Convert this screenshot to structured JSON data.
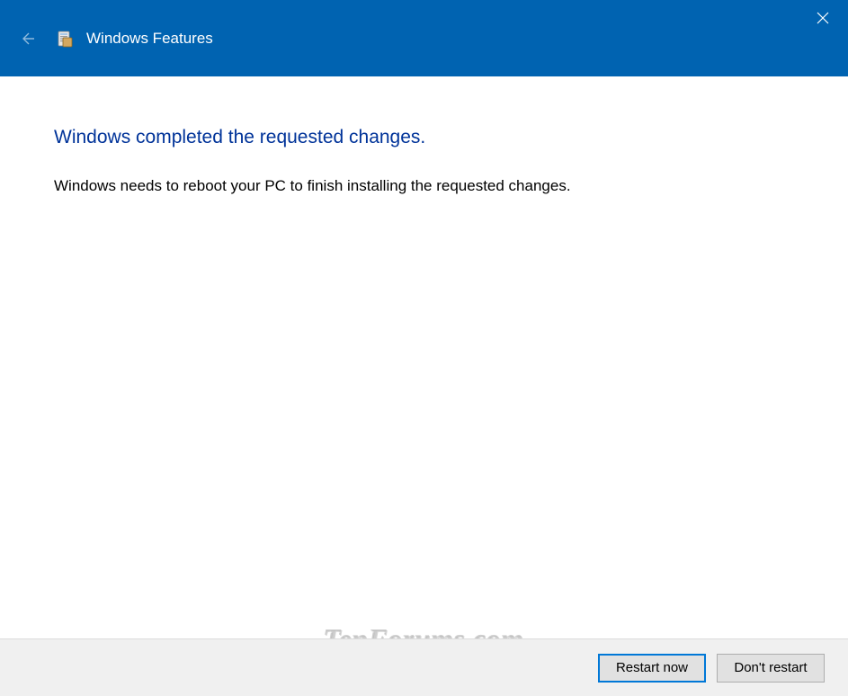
{
  "titlebar": {
    "title": "Windows Features"
  },
  "content": {
    "heading": "Windows completed the requested changes.",
    "body": "Windows needs to reboot your PC to finish installing the requested changes."
  },
  "footer": {
    "restart_label": "Restart now",
    "dont_restart_label": "Don't restart"
  },
  "watermark": "TenForums.com"
}
